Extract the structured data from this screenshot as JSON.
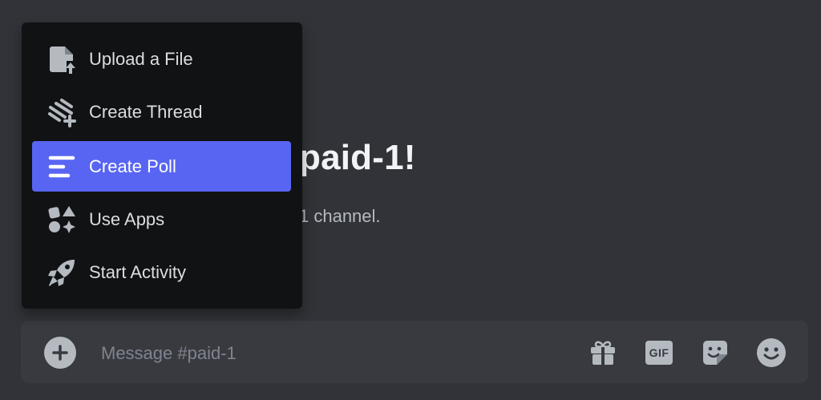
{
  "colors": {
    "background": "#313338",
    "menu_bg": "#111214",
    "active_item": "#5865f2",
    "composer_bg": "#383a40"
  },
  "welcome": {
    "title_visible": "paid-1!",
    "subtitle_visible": "1 channel."
  },
  "menu": {
    "items": [
      {
        "label": "Upload a File",
        "icon": "upload-file-icon",
        "active": false
      },
      {
        "label": "Create Thread",
        "icon": "thread-icon",
        "active": false
      },
      {
        "label": "Create Poll",
        "icon": "poll-icon",
        "active": true
      },
      {
        "label": "Use Apps",
        "icon": "apps-icon",
        "active": false
      },
      {
        "label": "Start Activity",
        "icon": "rocket-icon",
        "active": false
      }
    ]
  },
  "composer": {
    "placeholder": "Message #paid-1",
    "gif_label": "GIF",
    "tools": [
      "gift-icon",
      "gif-icon",
      "sticker-icon",
      "emoji-icon"
    ]
  }
}
